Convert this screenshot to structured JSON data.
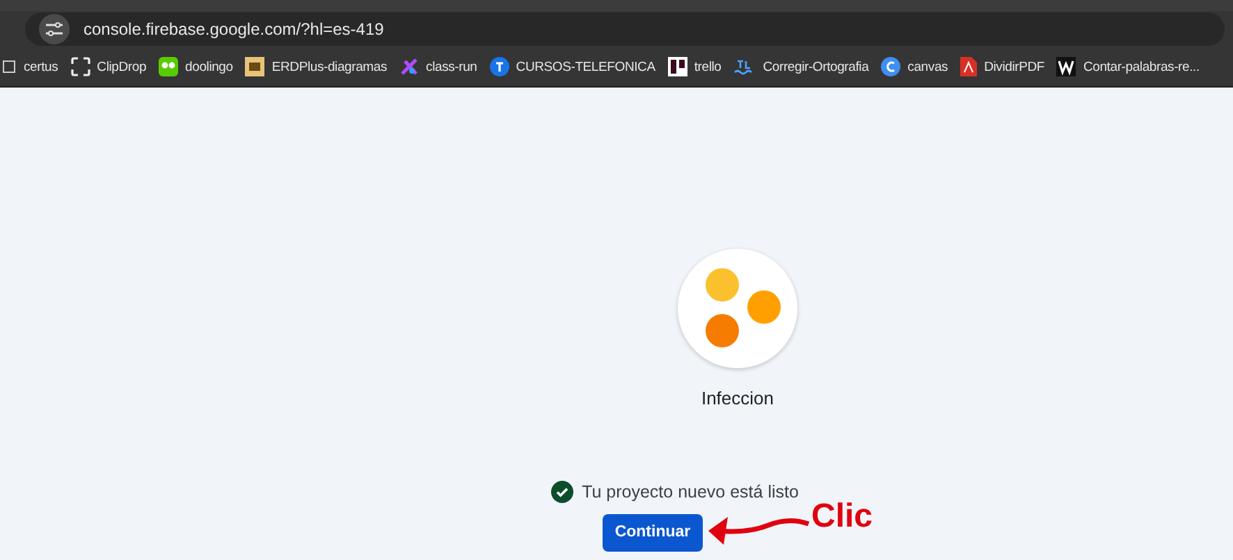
{
  "browser": {
    "url": "console.firebase.google.com/?hl=es-419",
    "bookmarks": [
      {
        "kind": "box",
        "label": "certus"
      },
      {
        "kind": "brackets",
        "label": "ClipDrop"
      },
      {
        "kind": "owl",
        "label": "doolingo"
      },
      {
        "kind": "er",
        "label": "ERDPlus-diagramas"
      },
      {
        "kind": "star",
        "label": "class-run"
      },
      {
        "kind": "circle-t",
        "label": "CURSOS-TELEFONICA"
      },
      {
        "kind": "board",
        "label": "trello"
      },
      {
        "kind": "wave",
        "label": "Corregir-Ortografia"
      },
      {
        "kind": "circle-c",
        "label": "canvas"
      },
      {
        "kind": "pdf",
        "label": "DividirPDF"
      },
      {
        "kind": "w",
        "label": "Contar-palabras-re..."
      }
    ]
  },
  "project": {
    "name": "Infeccion",
    "status": "Tu proyecto nuevo está listo",
    "button": "Continuar"
  },
  "annotation": {
    "text": "Clic"
  }
}
